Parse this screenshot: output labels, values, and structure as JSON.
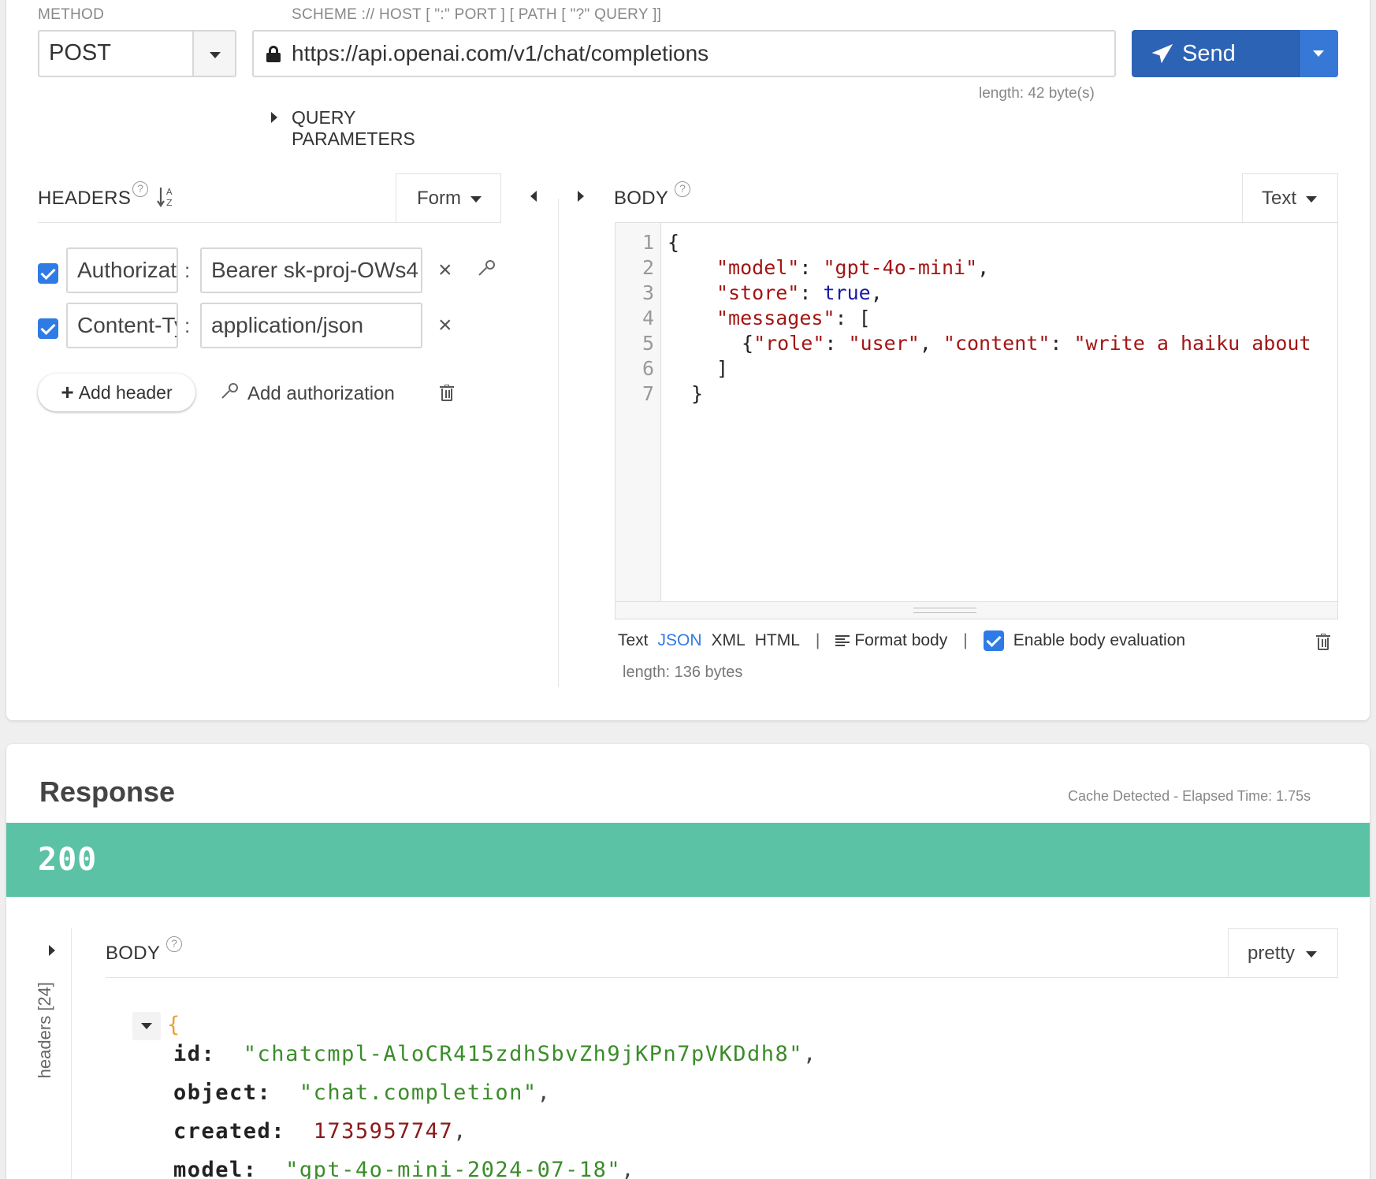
{
  "request": {
    "method_label": "METHOD",
    "method_value": "POST",
    "url_label": "SCHEME :// HOST [ \":\" PORT ] [ PATH [ \"?\" QUERY ]]",
    "url_value": "https://api.openai.com/v1/chat/completions",
    "url_length": "length: 42 byte(s)",
    "send_label": "Send",
    "query_params_label": "QUERY PARAMETERS"
  },
  "headers": {
    "title": "HEADERS",
    "help": "?",
    "mode": "Form",
    "rows": [
      {
        "name": "Authorization",
        "value": "Bearer sk-proj-OWs4"
      },
      {
        "name": "Content-Type",
        "value": "application/json"
      }
    ],
    "separator": ":",
    "add_header_label": "Add header",
    "add_auth_label": "Add authorization"
  },
  "body": {
    "title": "BODY",
    "help": "?",
    "mode": "Text",
    "line_numbers": [
      "1",
      "2",
      "3",
      "4",
      "5",
      "6",
      "7"
    ],
    "code": {
      "l1": "{",
      "l2_key": "\"model\"",
      "l2_val": "\"gpt-4o-mini\"",
      "l3_key": "\"store\"",
      "l3_val": "true",
      "l4_key": "\"messages\"",
      "l4_rest": ": [",
      "l5_open": "{",
      "l5_k1": "\"role\"",
      "l5_v1": "\"user\"",
      "l5_k2": "\"content\"",
      "l5_v2": "\"write a haiku about",
      "l6": "]",
      "l7": "}"
    },
    "formats": [
      "Text",
      "JSON",
      "XML",
      "HTML"
    ],
    "active_format": "JSON",
    "format_body_label": "Format body",
    "enable_eval_label": "Enable body evaluation",
    "length": "length: 136 bytes"
  },
  "response": {
    "title": "Response",
    "cache_elapsed": "Cache Detected -  Elapsed Time: 1.75s",
    "status": "200",
    "headers_tab": "headers [24]",
    "body_title": "BODY",
    "body_help": "?",
    "body_mode": "pretty",
    "json": {
      "open": "{",
      "id_key": "id:",
      "id_val": "\"chatcmpl-AloCR415zdhSbvZh9jKPn7pVKDdh8\"",
      "object_key": "object:",
      "object_val": "\"chat.completion\"",
      "created_key": "created:",
      "created_val": "1735957747",
      "model_key": "model:",
      "model_val": "\"gpt-4o-mini-2024-07-18\""
    }
  },
  "colors": {
    "accent": "#2d63b5",
    "status_ok": "#5cc2a5",
    "checkbox": "#2f7be6"
  }
}
